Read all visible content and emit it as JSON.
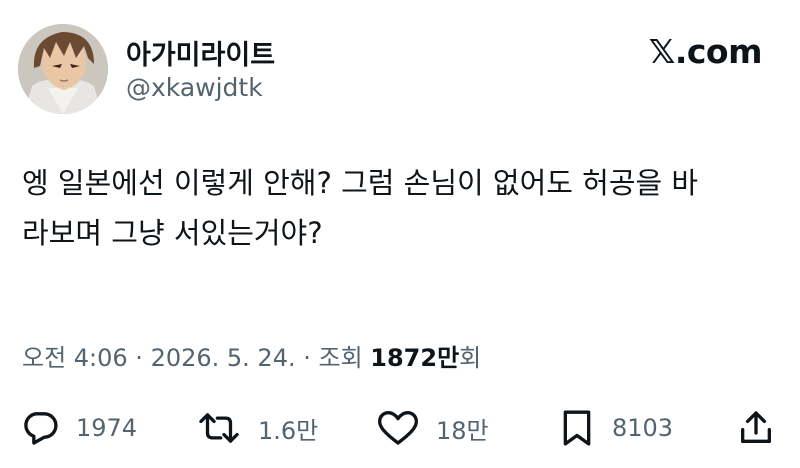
{
  "user": {
    "display_name": "아가미라이트",
    "handle": "@xkawjdtk"
  },
  "site": {
    "logo_text": "𝕏.com"
  },
  "tweet": {
    "text": "엥 일본에선 이렇게 안해? 그럼 손님이 없어도 허공을 바\n라보며 그냥 서있는거야?"
  },
  "meta": {
    "time_date": "오전 4:06 · 2026. 5. 24. · 조회 ",
    "views_count": "1872만",
    "views_suffix": "회"
  },
  "actions": {
    "replies": "1974",
    "retweets": "1.6만",
    "likes": "18만",
    "bookmarks": "8103"
  },
  "icons": {
    "reply": "reply-icon",
    "retweet": "retweet-icon",
    "like": "heart-icon",
    "bookmark": "bookmark-icon",
    "share": "share-icon"
  },
  "colors": {
    "primary_text": "#0f1419",
    "secondary_text": "#536471",
    "background": "#ffffff"
  }
}
